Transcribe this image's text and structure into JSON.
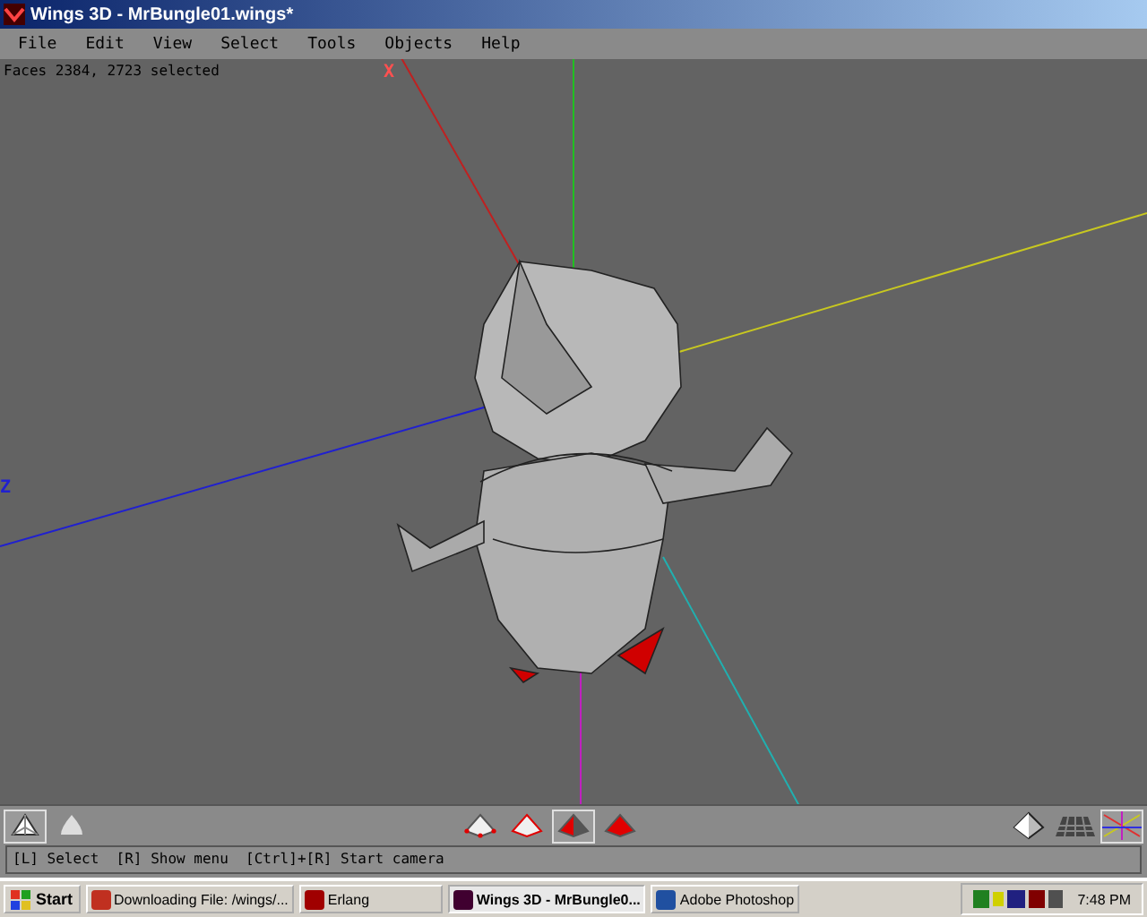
{
  "window": {
    "title": "Wings 3D - MrBungle01.wings*"
  },
  "menu": [
    "File",
    "Edit",
    "View",
    "Select",
    "Tools",
    "Objects",
    "Help"
  ],
  "viewport": {
    "info": "Faces 2384, 2723 selected",
    "axis_labels": [
      {
        "text": "X",
        "kind": "x"
      },
      {
        "text": "Z",
        "kind": "z"
      }
    ]
  },
  "toolbar": {
    "left": [
      {
        "kind": "flat",
        "selected": true
      },
      {
        "kind": "smooth",
        "selected": false
      }
    ],
    "modes": [
      {
        "kind": "vertex",
        "selected": false
      },
      {
        "kind": "edge",
        "selected": false
      },
      {
        "kind": "face",
        "selected": true
      },
      {
        "kind": "body",
        "selected": false
      }
    ],
    "right": [
      {
        "kind": "persp",
        "selected": false
      },
      {
        "kind": "grid",
        "selected": false
      },
      {
        "kind": "axes",
        "selected": true
      }
    ]
  },
  "status": "[L] Select  [R] Show menu  [Ctrl]+[R] Start camera",
  "taskbar": {
    "start": "Start",
    "tasks": [
      {
        "label": "Downloading File: /wings/...",
        "selected": false
      },
      {
        "label": "Erlang",
        "selected": false
      },
      {
        "label": "Wings 3D - MrBungle0...",
        "selected": true
      },
      {
        "label": "Adobe Photoshop",
        "selected": false
      }
    ],
    "clock": "7:48 PM"
  }
}
